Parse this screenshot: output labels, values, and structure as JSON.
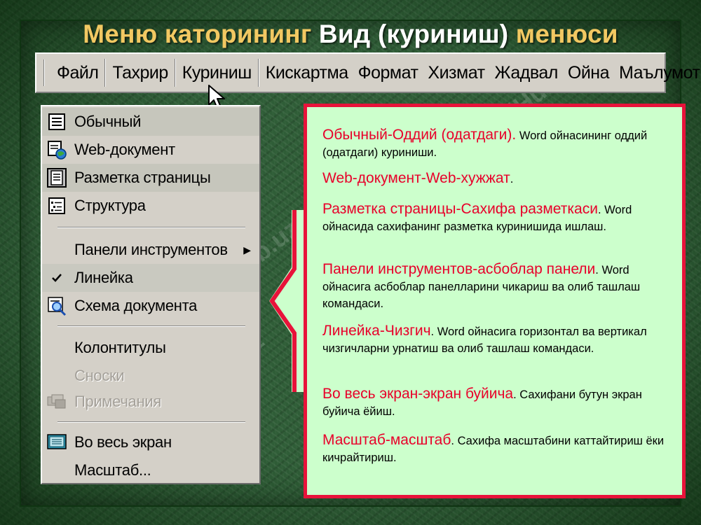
{
  "slide_title": {
    "part1": "Меню каторининг",
    "part2": "Вид (куриниш)",
    "part3": "менюси"
  },
  "menubar": {
    "items": [
      "Файл",
      "Тахрир",
      "Куриниш",
      "Кискартма",
      "Формат",
      "Хизмат",
      "Жадвал",
      "Ойна",
      "Маълумот"
    ]
  },
  "dropdown": {
    "items": [
      {
        "label": "Обычный",
        "icon": "normal-view-icon"
      },
      {
        "label": "Web-документ",
        "icon": "web-document-icon"
      },
      {
        "label": "Разметка страницы",
        "icon": "page-layout-icon"
      },
      {
        "label": "Структура",
        "icon": "outline-icon"
      },
      {
        "label": "Панели инструментов",
        "icon": "submenu-arrow-icon"
      },
      {
        "label": "Линейка",
        "icon": "check-icon"
      },
      {
        "label": "Схема документа",
        "icon": "document-map-icon"
      },
      {
        "label": "Колонтитулы",
        "icon": ""
      },
      {
        "label": "Сноски",
        "icon": ""
      },
      {
        "label": "Примечания",
        "icon": "comments-icon"
      },
      {
        "label": "Во весь экран",
        "icon": "full-screen-icon"
      },
      {
        "label": "Масштаб...",
        "icon": ""
      }
    ]
  },
  "descriptions": [
    {
      "term": "Обычный-Оддий (одатдаги).",
      "text": " Word ойнасининг  оддий (одатдаги) куриниши."
    },
    {
      "term": "Web-документ-Web-хужжат",
      "text": "."
    },
    {
      "term": "Разметка страницы-Сахифа разметкаси",
      "text": ". Word ойнасида сахифанинг разметка куринишида ишлаш."
    },
    {
      "term": "Панели инструментов-асбоблар панели",
      "text": ". Word ойнасига асбоблар панелларини чикариш ва олиб ташлаш командаси."
    },
    {
      "term": "Линейка-Чизгич",
      "text": ".  Word ойнасига горизонтал ва вертикал чизгичларни урнатиш ва олиб ташлаш командаси."
    },
    {
      "term": "Во весь экран-экран буйича",
      "text": ".  Сахифани бутун экран буйича ёйиш."
    },
    {
      "term": "Масштаб-масштаб",
      "text": ".  Сахифа масштабини каттайтириш  ёки кичрайтириш."
    }
  ],
  "watermark": "FaylHub.uz",
  "colors": {
    "title_yellow": "#f2c862",
    "panel_background": "#ccffcc",
    "accent_red": "#e8123a"
  }
}
